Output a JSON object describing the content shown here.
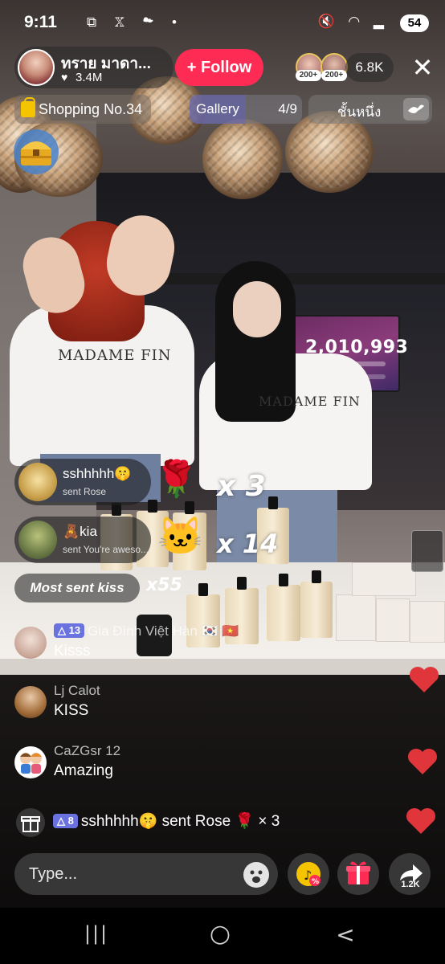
{
  "status_bar": {
    "time": "9:11",
    "left_icons": "⧉ 𝕏 ☁ •",
    "right_icons": "🔇 ◠ ▂",
    "battery": "54"
  },
  "header": {
    "host_name": "ทราย มาดา...",
    "host_likes": "3.4M",
    "follow_label": "+ Follow",
    "viewer_badges": [
      "200+",
      "200+"
    ],
    "viewer_count": "6.8K",
    "close_icon": "✕"
  },
  "pills": {
    "shopping_label": "Shopping No.34",
    "gallery_label": "Gallery",
    "gallery_count": "4/9",
    "song_label": "ชั้นหนึ่ง"
  },
  "stream": {
    "monitor_number": "2,010,993",
    "shirt_text_1": "MADAME FIN",
    "shirt_text_2": "MADAME FIN"
  },
  "gifts": [
    {
      "user": "sshhhhh🤫",
      "sub": "sent Rose",
      "item": "🌹",
      "multiplier": "x 3"
    },
    {
      "user": "🧸kia",
      "sub": "sent You're aweso...",
      "item": "🐱",
      "multiplier": "x 14"
    }
  ],
  "most_sent": {
    "label": "Most sent kiss",
    "multiplier": "x55"
  },
  "comments": [
    {
      "badge": "△ 13",
      "user": "Gia Đình Việt Hàn 🇰🇷 🇻🇳",
      "text": "Kisss"
    },
    {
      "badge": "",
      "user": "Lj Calot",
      "text": "KISS"
    },
    {
      "badge": "",
      "user": "CaZGsr 12",
      "text": "Amazing"
    }
  ],
  "gift_line": {
    "badge": "△ 8",
    "text": "sshhhhh🤫 sent Rose 🌹 × 3"
  },
  "bottom_bar": {
    "input_placeholder": "Type...",
    "share_count": "1.2K"
  },
  "nav": {
    "recents": "|||",
    "home": "○",
    "back": "<"
  },
  "colors": {
    "follow": "#fe2c55",
    "heart": "#e0353a",
    "level_badge": "#6a72e0"
  },
  "icons": [
    "heart-icon",
    "close-icon",
    "shopping-bag-icon",
    "gift-icon",
    "share-icon",
    "emoji-icon",
    "tiktok-coin-icon",
    "treasure-chest-icon",
    "bird-icon"
  ]
}
